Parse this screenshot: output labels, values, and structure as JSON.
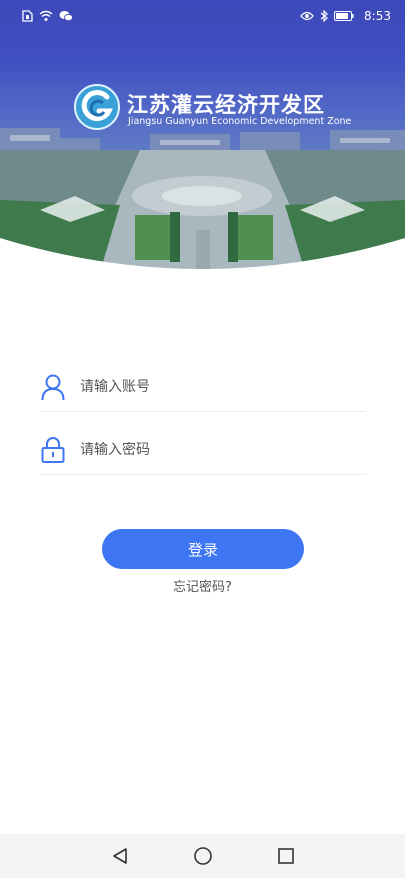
{
  "status_bar": {
    "time": "8:53"
  },
  "header": {
    "title_cn": "江苏灌云经济开发区",
    "title_en": "Jiangsu Guanyun Economic Development Zone"
  },
  "login": {
    "account_placeholder": "请输入账号",
    "password_placeholder": "请输入密码",
    "login_label": "登录",
    "forgot_label": "忘记密码?"
  },
  "colors": {
    "accent": "#3d75f2",
    "header": "#3f4ec2"
  },
  "icons": {
    "account": "user-icon",
    "password": "lock-icon",
    "back": "back-triangle-icon",
    "home": "home-circle-icon",
    "recents": "recents-square-icon"
  }
}
